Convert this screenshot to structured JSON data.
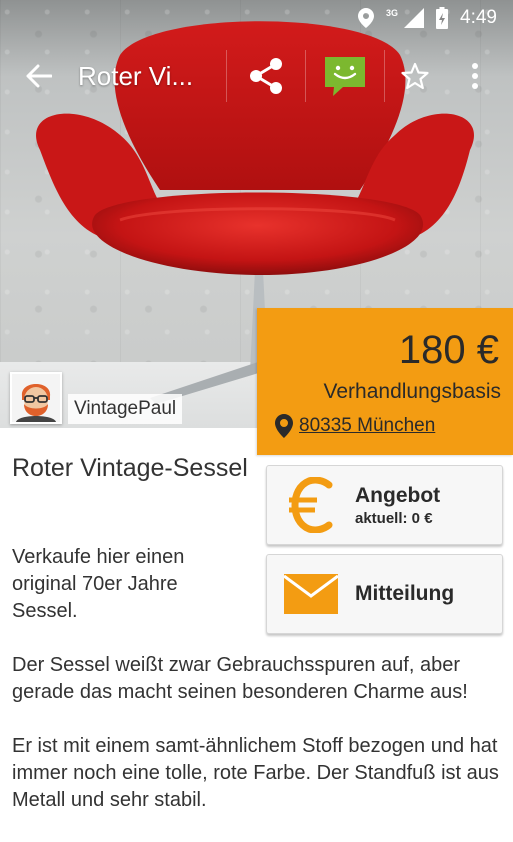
{
  "status_bar": {
    "network": "3G",
    "time": "4:49",
    "icons": [
      "location-icon",
      "signal-icon",
      "battery-icon"
    ]
  },
  "toolbar": {
    "title": "Roter Vi...",
    "icons": [
      "back-arrow-icon",
      "share-icon",
      "chat-icon",
      "star-icon",
      "overflow-menu-icon"
    ]
  },
  "seller": {
    "name": "VintagePaul"
  },
  "price_box": {
    "price": "180 €",
    "terms": "Verhandlungsbasis",
    "location": "80335 München"
  },
  "item": {
    "title": "Roter Vintage-Sessel"
  },
  "description": [
    "Verkaufe hier einen original 70er Jahre Sessel.",
    "Der Sessel weißt zwar Gebrauchsspuren auf, aber gerade das macht seinen besonderen Charme aus!",
    "Er ist mit einem samt-ähnlichem Stoff bezogen und hat immer noch eine tolle, rote Farbe. Der Standfuß ist aus Metall und sehr stabil."
  ],
  "actions": {
    "offer": {
      "label": "Angebot",
      "current": "aktuell: 0 €"
    },
    "message": {
      "label": "Mitteilung"
    }
  },
  "colors": {
    "accent": "#f39c12",
    "chat_green": "#7cb82f",
    "chair_red": "#d11f1f"
  }
}
